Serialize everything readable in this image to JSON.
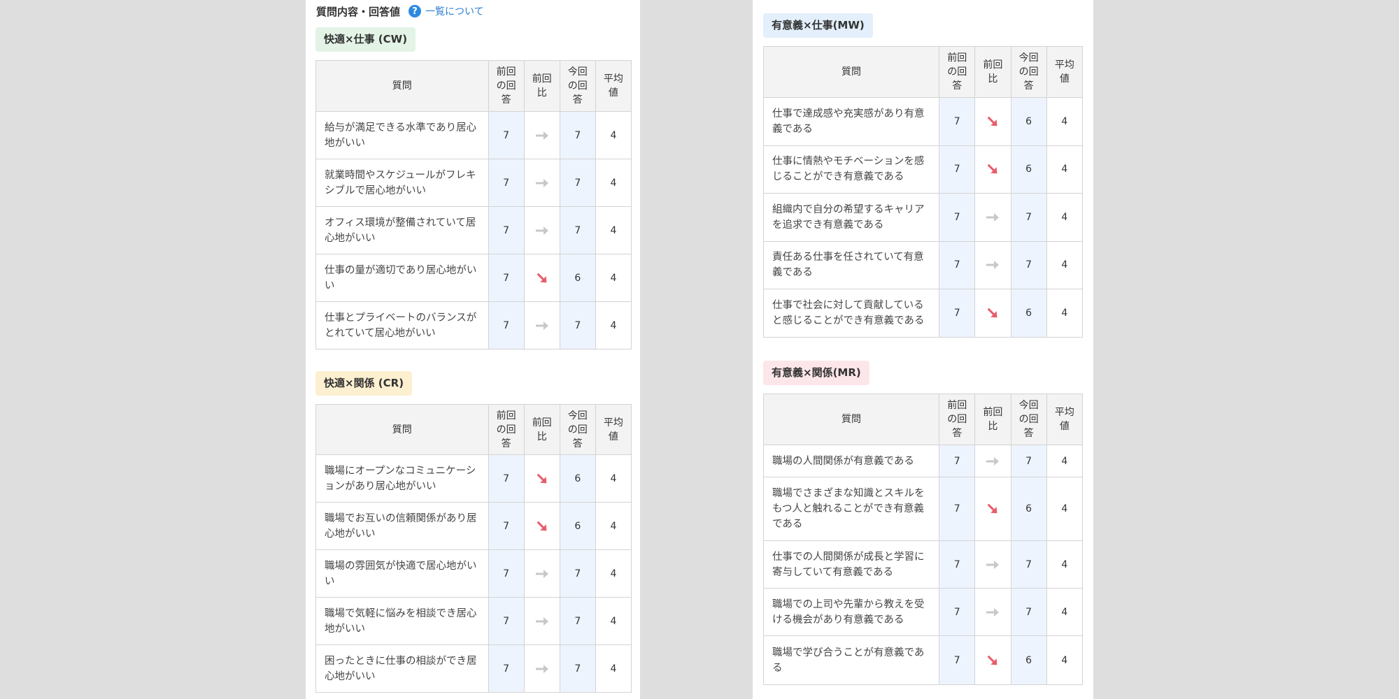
{
  "header": {
    "title": "質問内容・回答値",
    "help_icon": "?",
    "about_link": "一覧について"
  },
  "table_headers": {
    "question": "質問",
    "prev_answer": "前回の回答",
    "prev_diff": "前回比",
    "current_answer": "今回の回答",
    "average": "平均値"
  },
  "icons": {
    "same": "arrow-right-icon",
    "down": "arrow-down-right-icon"
  },
  "colors": {
    "same": "#c8c8c8",
    "down": "#e85d6a",
    "answer_bg": "#eef4fe",
    "link": "#2d7dd2"
  },
  "sections": [
    {
      "label": "快適×仕事 (CW)",
      "rows": [
        {
          "question": "給与が満足できる水準であり居心地がいい",
          "prev": "7",
          "trend": "same",
          "current": "7",
          "avg": "4"
        },
        {
          "question": "就業時間やスケジュールがフレキシブルで居心地がいい",
          "prev": "7",
          "trend": "same",
          "current": "7",
          "avg": "4"
        },
        {
          "question": "オフィス環境が整備されていて居心地がいい",
          "prev": "7",
          "trend": "same",
          "current": "7",
          "avg": "4"
        },
        {
          "question": "仕事の量が適切であり居心地がいい",
          "prev": "7",
          "trend": "down",
          "current": "6",
          "avg": "4"
        },
        {
          "question": "仕事とプライベートのバランスがとれていて居心地がいい",
          "prev": "7",
          "trend": "same",
          "current": "7",
          "avg": "4"
        }
      ]
    },
    {
      "label": "快適×関係 (CR)",
      "rows": [
        {
          "question": "職場にオープンなコミュニケーションがあり居心地がいい",
          "prev": "7",
          "trend": "down",
          "current": "6",
          "avg": "4"
        },
        {
          "question": "職場でお互いの信頼関係があり居心地がいい",
          "prev": "7",
          "trend": "down",
          "current": "6",
          "avg": "4"
        },
        {
          "question": "職場の雰囲気が快適で居心地がいい",
          "prev": "7",
          "trend": "same",
          "current": "7",
          "avg": "4"
        },
        {
          "question": "職場で気軽に悩みを相談でき居心地がいい",
          "prev": "7",
          "trend": "same",
          "current": "7",
          "avg": "4"
        },
        {
          "question": "困ったときに仕事の相談ができ居心地がいい",
          "prev": "7",
          "trend": "same",
          "current": "7",
          "avg": "4"
        }
      ]
    },
    {
      "label": "有意義×仕事(MW)",
      "rows": [
        {
          "question": "仕事で達成感や充実感があり有意義である",
          "prev": "7",
          "trend": "down",
          "current": "6",
          "avg": "4"
        },
        {
          "question": "仕事に情熱やモチベーションを感じることができ有意義である",
          "prev": "7",
          "trend": "down",
          "current": "6",
          "avg": "4"
        },
        {
          "question": "組織内で自分の希望するキャリアを追求でき有意義である",
          "prev": "7",
          "trend": "same",
          "current": "7",
          "avg": "4"
        },
        {
          "question": "責任ある仕事を任されていて有意義である",
          "prev": "7",
          "trend": "same",
          "current": "7",
          "avg": "4"
        },
        {
          "question": "仕事で社会に対して貢献していると感じることができ有意義である",
          "prev": "7",
          "trend": "down",
          "current": "6",
          "avg": "4"
        }
      ]
    },
    {
      "label": "有意義×関係(MR)",
      "rows": [
        {
          "question": "職場の人間関係が有意義である",
          "prev": "7",
          "trend": "same",
          "current": "7",
          "avg": "4"
        },
        {
          "question": "職場でさまざまな知識とスキルをもつ人と触れることができ有意義である",
          "prev": "7",
          "trend": "down",
          "current": "6",
          "avg": "4"
        },
        {
          "question": "仕事での人間関係が成長と学習に寄与していて有意義である",
          "prev": "7",
          "trend": "same",
          "current": "7",
          "avg": "4"
        },
        {
          "question": "職場での上司や先輩から教えを受ける機会があり有意義である",
          "prev": "7",
          "trend": "same",
          "current": "7",
          "avg": "4"
        },
        {
          "question": "職場で学び合うことが有意義である",
          "prev": "7",
          "trend": "down",
          "current": "6",
          "avg": "4"
        }
      ]
    }
  ]
}
